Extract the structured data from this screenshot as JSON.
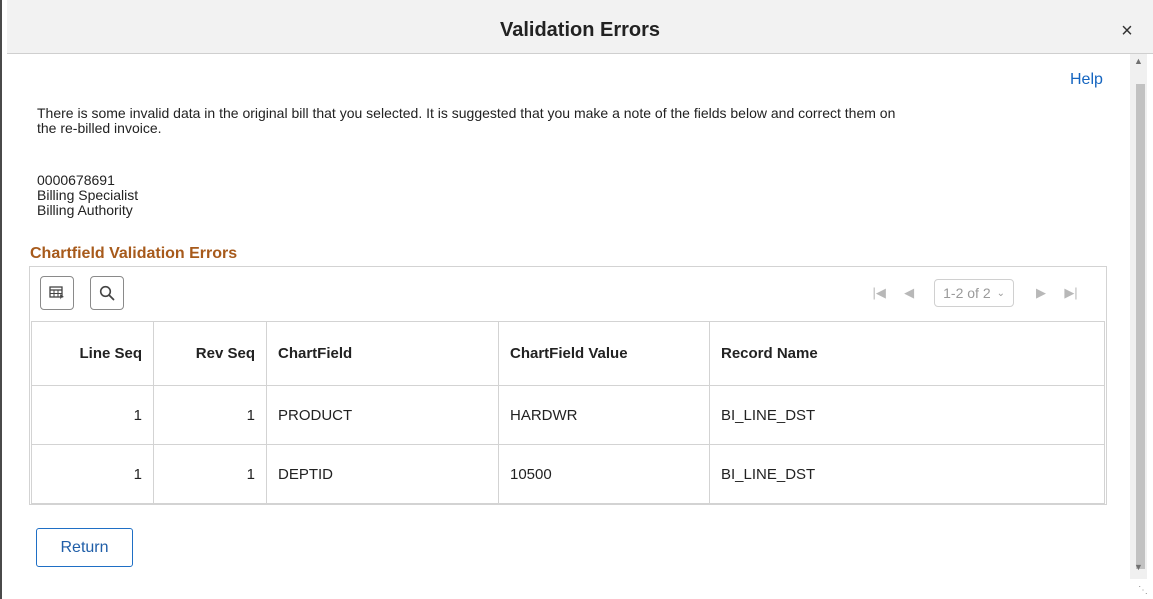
{
  "dialog": {
    "title": "Validation Errors",
    "close_glyph": "×",
    "help_label": "Help",
    "intro_text": "There is some invalid data in the original bill that you selected. It is suggested that you make a note of the fields below and correct them on the re-billed invoice.",
    "info_lines": [
      "0000678691",
      "Billing Specialist",
      "Billing Authority"
    ],
    "section_title": "Chartfield Validation Errors",
    "return_label": "Return"
  },
  "grid": {
    "toolbar_icons": [
      "personalize-grid-icon",
      "search-icon"
    ],
    "pager": {
      "range_label": "1-2 of 2",
      "first_glyph": "|◀",
      "prev_glyph": "◀",
      "next_glyph": "▶",
      "last_glyph": "▶|"
    },
    "columns": [
      "Line Seq",
      "Rev Seq",
      "ChartField",
      "ChartField Value",
      "Record Name"
    ],
    "rows": [
      [
        "1",
        "1",
        "PRODUCT",
        "HARDWR",
        "BI_LINE_DST"
      ],
      [
        "1",
        "1",
        "DEPTID",
        "10500",
        "BI_LINE_DST"
      ]
    ]
  },
  "colors": {
    "section_title": "#a75a1b",
    "link": "#1565c0",
    "button_border": "#1f6fc5"
  }
}
